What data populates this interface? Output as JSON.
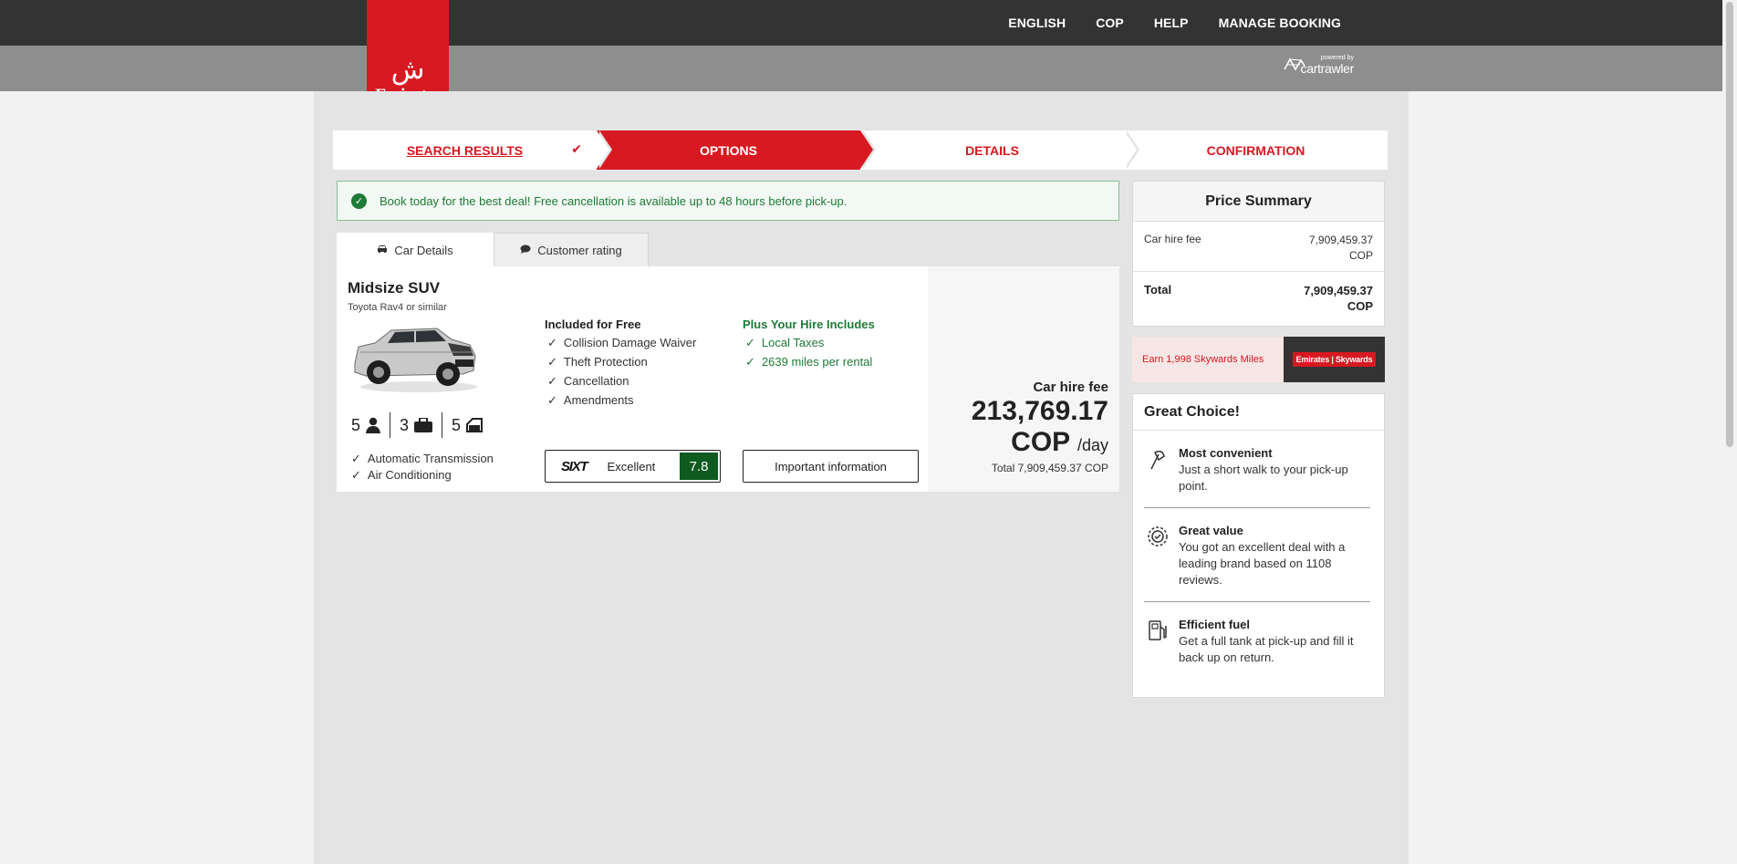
{
  "header": {
    "nav": [
      "ENGLISH",
      "COP",
      "HELP",
      "MANAGE BOOKING"
    ],
    "logo_text": "Emirates",
    "powered_by": "powered by",
    "powered_brand": "cartrawler"
  },
  "steps": [
    {
      "label": "SEARCH RESULTS",
      "state": "done"
    },
    {
      "label": "OPTIONS",
      "state": "active"
    },
    {
      "label": "DETAILS",
      "state": "upcoming"
    },
    {
      "label": "CONFIRMATION",
      "state": "upcoming"
    }
  ],
  "notice": "Book today for the best deal! Free cancellation is available up to 48 hours before pick-up.",
  "tabs": {
    "car_details": "Car Details",
    "customer_rating": "Customer rating"
  },
  "car": {
    "name": "Midsize SUV",
    "model": "Toyota Rav4 or similar",
    "seats": "5",
    "bags": "3",
    "doors": "5",
    "features": [
      "Automatic Transmission",
      "Air Conditioning"
    ],
    "included_title": "Included for Free",
    "included": [
      "Collision Damage Waiver",
      "Theft Protection",
      "Cancellation",
      "Amendments"
    ],
    "plus_title": "Plus Your Hire Includes",
    "plus": [
      "Local Taxes",
      "2639 miles per rental"
    ],
    "supplier": "SIXT",
    "rating_label": "Excellent",
    "rating_score": "7.8",
    "info_button": "Important information",
    "price_label": "Car hire fee",
    "price_value": "213,769.17",
    "price_currency": "COP",
    "price_per": "/day",
    "price_total": "Total 7,909,459.37 COP"
  },
  "summary": {
    "title": "Price Summary",
    "fee_label": "Car hire fee",
    "fee_value": "7,909,459.37",
    "fee_currency": "COP",
    "total_label": "Total",
    "total_value": "7,909,459.37",
    "total_currency": "COP"
  },
  "miles": {
    "text": "Earn 1,998 Skywards Miles",
    "badge": "Emirates | Skywards"
  },
  "choice": {
    "title": "Great Choice!",
    "reasons": [
      {
        "title": "Most convenient",
        "text": "Just a short walk to your pick-up point."
      },
      {
        "title": "Great value",
        "text": "You got an excellent deal with a leading brand based on 1108 reviews."
      },
      {
        "title": "Efficient fuel",
        "text": "Get a full tank at pick-up and fill it back up on return."
      }
    ]
  }
}
